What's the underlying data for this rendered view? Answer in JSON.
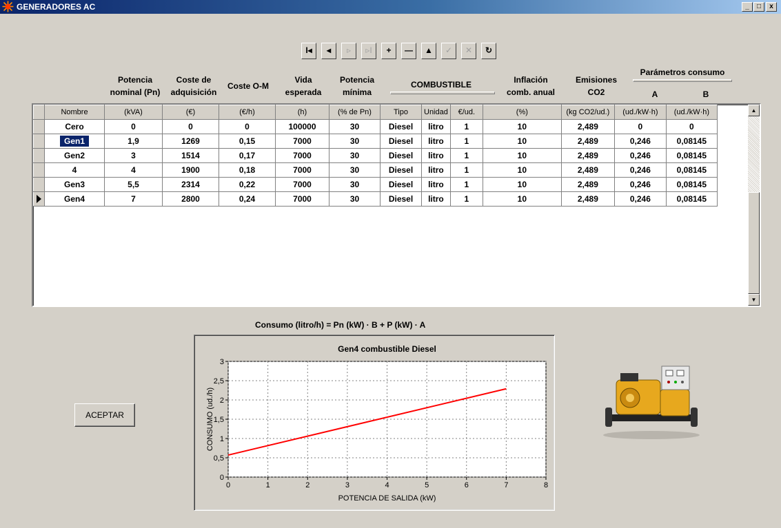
{
  "window": {
    "title": "GENERADORES AC",
    "controls": [
      "_",
      "□",
      "x"
    ]
  },
  "toolbar": {
    "buttons": [
      {
        "icon": "first-record-icon",
        "glyph": "I◂",
        "enabled": true
      },
      {
        "icon": "prior-record-icon",
        "glyph": "◂",
        "enabled": true
      },
      {
        "icon": "next-record-icon",
        "glyph": "▹",
        "enabled": false
      },
      {
        "icon": "last-record-icon",
        "glyph": "▹I",
        "enabled": false
      },
      {
        "icon": "insert-record-icon",
        "glyph": "+",
        "enabled": true
      },
      {
        "icon": "delete-record-icon",
        "glyph": "—",
        "enabled": true
      },
      {
        "icon": "edit-record-icon",
        "glyph": "▲",
        "enabled": true
      },
      {
        "icon": "post-record-icon",
        "glyph": "✓",
        "enabled": false
      },
      {
        "icon": "cancel-edit-icon",
        "glyph": "✕",
        "enabled": false
      },
      {
        "icon": "refresh-icon",
        "glyph": "↻",
        "enabled": true
      }
    ]
  },
  "headers": {
    "potencia": "Potencia\nnominal (Pn)",
    "coste": "Coste de\nadquisición",
    "costeom": "Coste O-M",
    "vida": "Vida\nesperada",
    "potmin": "Potencia\nmínima",
    "combustible": "COMBUSTIBLE",
    "inflacion": "Inflación\ncomb. anual",
    "emisiones": "Emisiones\nCO2",
    "parametros": "Parámetros consumo",
    "a": "A",
    "b": "B"
  },
  "table": {
    "columns": [
      "Nombre",
      "(kVA)",
      "(€)",
      "(€/h)",
      "(h)",
      "(% de Pn)",
      "Tipo",
      "Unidad",
      "€/ud.",
      "(%)",
      "(kg CO2/ud.)",
      "(ud./kW·h)",
      "(ud./kW·h)"
    ],
    "rows": [
      [
        "Cero",
        "0",
        "0",
        "0",
        "100000",
        "30",
        "Diesel",
        "litro",
        "1",
        "10",
        "2,489",
        "0",
        "0"
      ],
      [
        "Gen1",
        "1,9",
        "1269",
        "0,15",
        "7000",
        "30",
        "Diesel",
        "litro",
        "1",
        "10",
        "2,489",
        "0,246",
        "0,08145"
      ],
      [
        "Gen2",
        "3",
        "1514",
        "0,17",
        "7000",
        "30",
        "Diesel",
        "litro",
        "1",
        "10",
        "2,489",
        "0,246",
        "0,08145"
      ],
      [
        "4",
        "4",
        "1900",
        "0,18",
        "7000",
        "30",
        "Diesel",
        "litro",
        "1",
        "10",
        "2,489",
        "0,246",
        "0,08145"
      ],
      [
        "Gen3",
        "5,5",
        "2314",
        "0,22",
        "7000",
        "30",
        "Diesel",
        "litro",
        "1",
        "10",
        "2,489",
        "0,246",
        "0,08145"
      ],
      [
        "Gen4",
        "7",
        "2800",
        "0,24",
        "7000",
        "30",
        "Diesel",
        "litro",
        "1",
        "10",
        "2,489",
        "0,246",
        "0,08145"
      ]
    ],
    "selected_name_row": 1,
    "current_row": 5
  },
  "formula": "Consumo (litro/h) = Pn (kW) · B + P (kW) · A",
  "accept_label": "ACEPTAR",
  "chart_data": {
    "type": "line",
    "title": "Gen4 combustible Diesel",
    "xlabel": "POTENCIA DE SALIDA (kW)",
    "ylabel": "CONSUMO (ud./h)",
    "xlim": [
      0,
      8
    ],
    "ylim": [
      0,
      3
    ],
    "xticks": [
      "0",
      "1",
      "2",
      "3",
      "4",
      "5",
      "6",
      "7",
      "8"
    ],
    "yticks": [
      "0",
      "0,5",
      "1",
      "1,5",
      "2",
      "2,5",
      "3"
    ],
    "grid": true,
    "series": [
      {
        "color": "#ff0000",
        "x": [
          0,
          7
        ],
        "y": [
          0.57,
          2.29
        ]
      }
    ]
  }
}
